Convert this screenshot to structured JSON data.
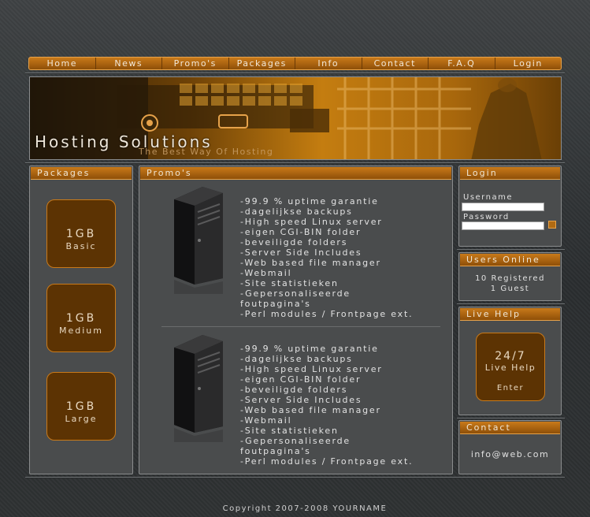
{
  "nav": {
    "items": [
      "Home",
      "News",
      "Promo's",
      "Packages",
      "Info",
      "Contact",
      "F.A.Q",
      "Login"
    ]
  },
  "banner": {
    "title": "Hosting Solutions",
    "subtitle": "The Best Way Of Hosting"
  },
  "packages": {
    "title": "Packages",
    "items": [
      {
        "size": "1GB",
        "name": "Basic"
      },
      {
        "size": "1GB",
        "name": "Medium"
      },
      {
        "size": "1GB",
        "name": "Large"
      }
    ]
  },
  "promos": {
    "title": "Promo's",
    "blocks": [
      {
        "features": [
          "-99.9 % uptime garantie",
          "-dagelijkse backups",
          "-High speed Linux server",
          "-eigen CGI-BIN folder",
          "-beveiligde folders",
          "-Server Side Includes",
          "-Web based file manager",
          "-Webmail",
          "-Site statistieken",
          "-Gepersonaliseerde",
          "foutpagina's",
          "-Perl modules / Frontpage ext."
        ]
      },
      {
        "features": [
          "-99.9 % uptime garantie",
          "-dagelijkse backups",
          "-High speed Linux server",
          "-eigen CGI-BIN folder",
          "-beveiligde folders",
          "-Server Side Includes",
          "-Web based file manager",
          "-Webmail",
          "-Site statistieken",
          "-Gepersonaliseerde",
          "foutpagina's",
          "-Perl modules / Frontpage ext."
        ]
      }
    ]
  },
  "login": {
    "title": "Login",
    "username_label": "Username",
    "password_label": "Password",
    "username_value": "",
    "password_value": ""
  },
  "users_online": {
    "title": "Users Online",
    "registered": "10 Registered",
    "guests": "1 Guest"
  },
  "live_help": {
    "title": "Live Help",
    "hours": "24/7",
    "label": "Live Help",
    "enter": "Enter"
  },
  "contact": {
    "title": "Contact",
    "email": "info@web.com"
  },
  "footer": {
    "copyright": "Copyright 2007-2008 YOURNAME"
  },
  "colors": {
    "accent": "#c97a1a",
    "accent_dark": "#5c3303",
    "panel": "#4a4c4d"
  }
}
